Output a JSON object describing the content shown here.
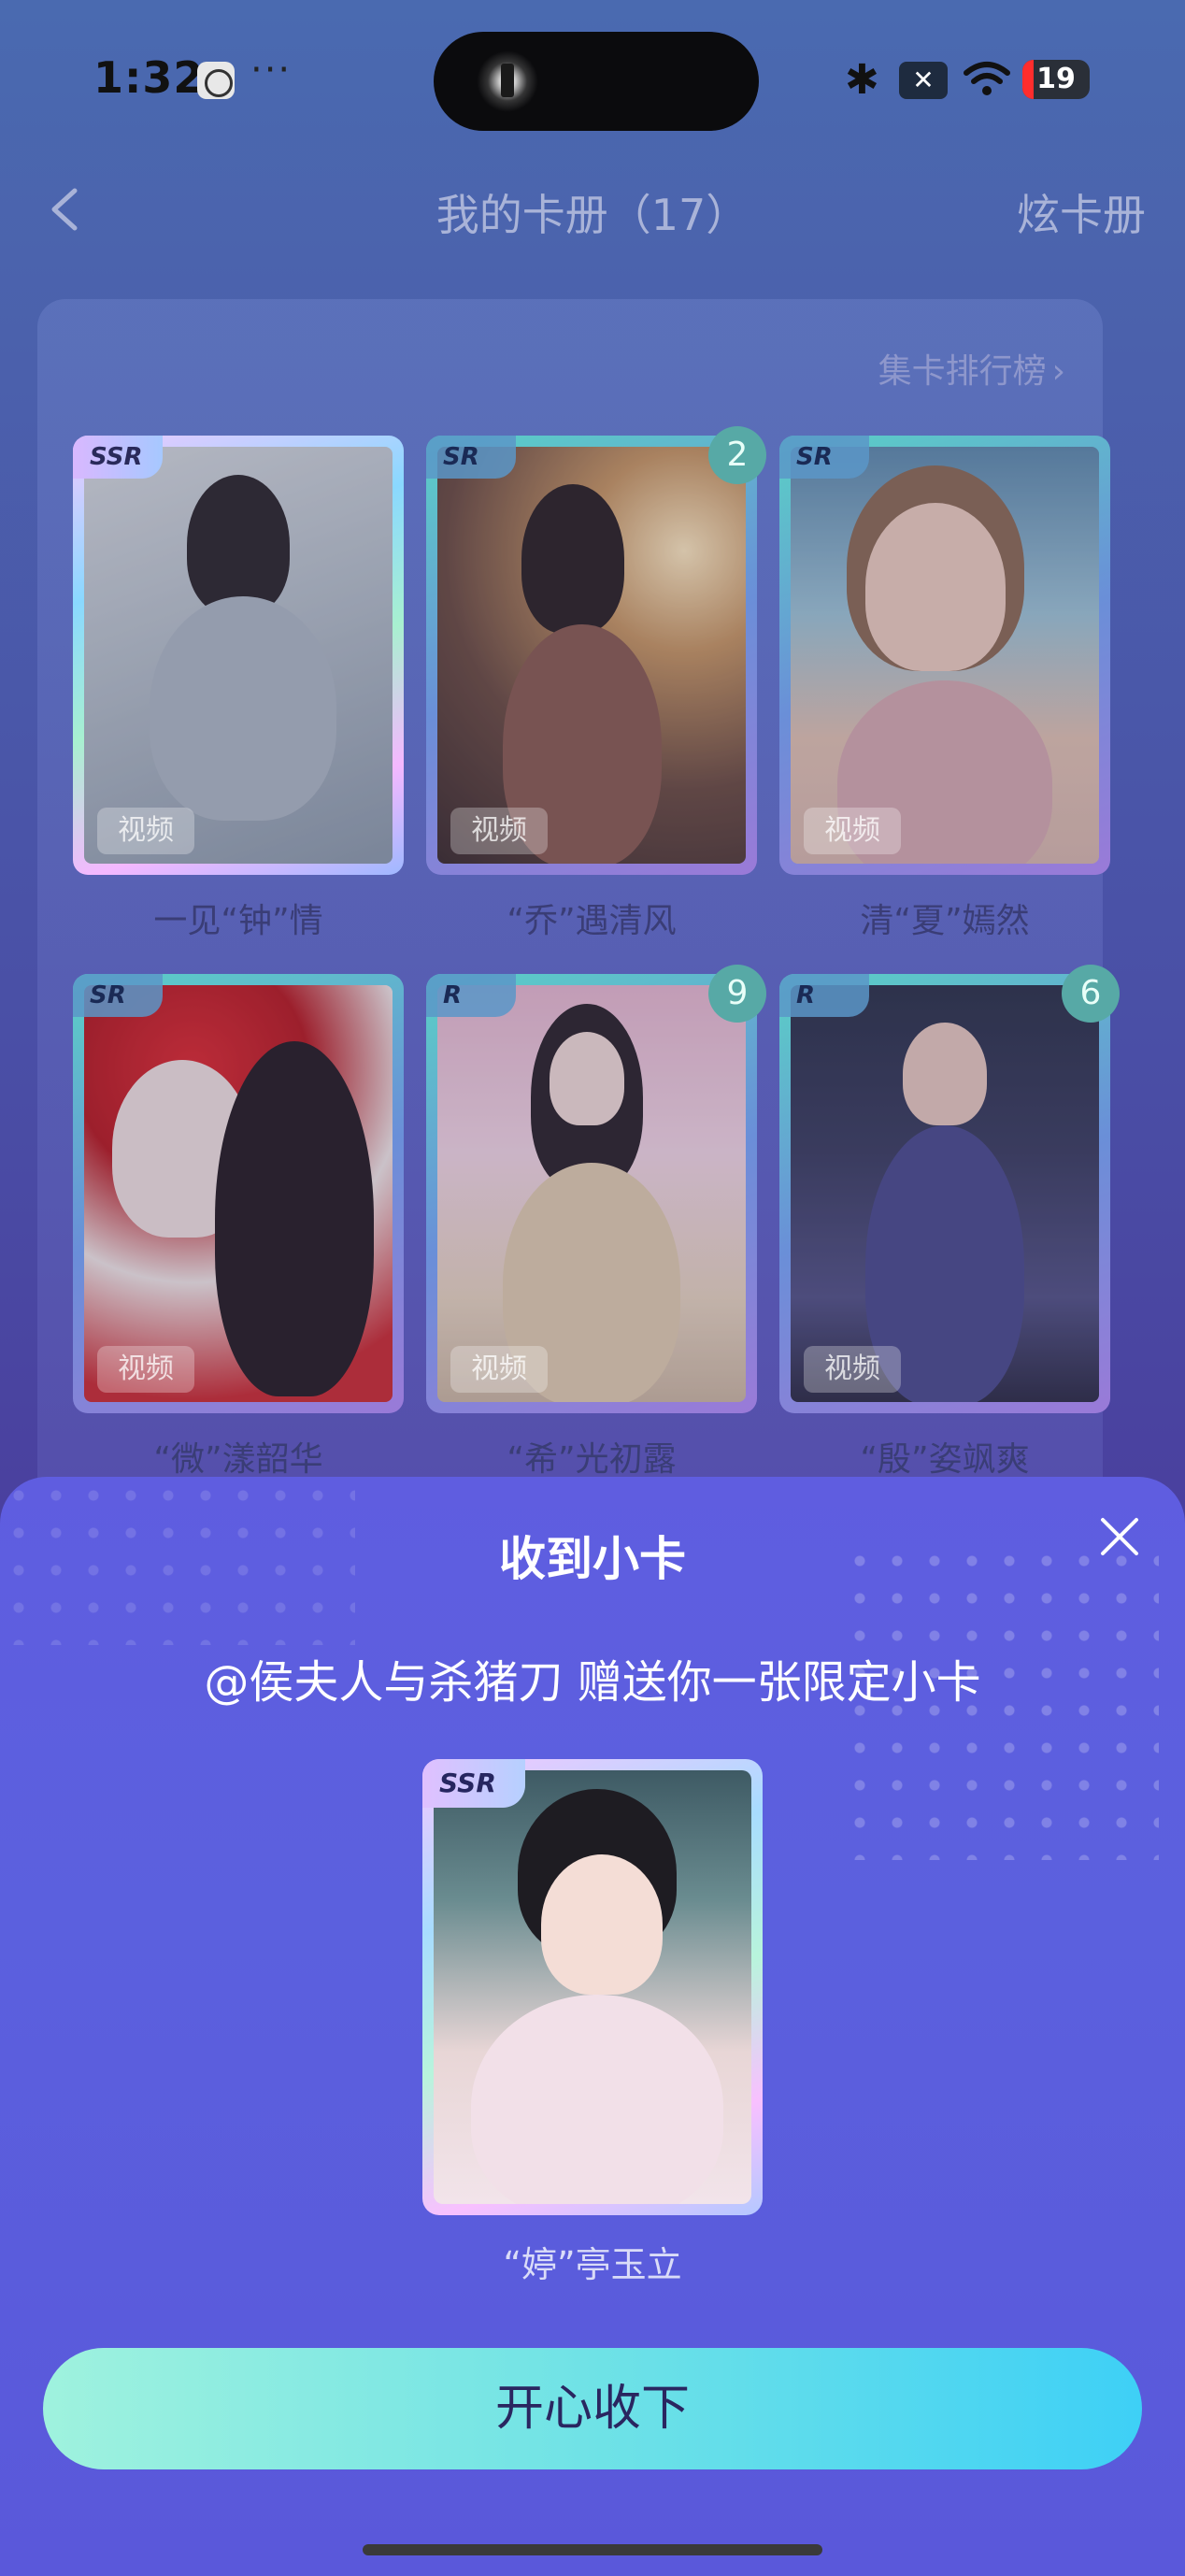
{
  "status_bar": {
    "time": "1:32",
    "dots": "···",
    "battery": "19"
  },
  "nav": {
    "title": "我的卡册（17）",
    "right_action": "炫卡册"
  },
  "album": {
    "rank_link": "集卡排行榜",
    "video_label": "视频",
    "cards": [
      {
        "name": "一见“钟”情",
        "rarity": "SSR",
        "count": ""
      },
      {
        "name": "“乔”遇清风",
        "rarity": "SR",
        "count": "2"
      },
      {
        "name": "清“夏”嫣然",
        "rarity": "SR",
        "count": ""
      },
      {
        "name": "“微”漾韶华",
        "rarity": "SR",
        "count": ""
      },
      {
        "name": "“希”光初露",
        "rarity": "R",
        "count": "9"
      },
      {
        "name": "“殷”姿飒爽",
        "rarity": "R",
        "count": "6"
      }
    ]
  },
  "gift_sheet": {
    "title": "收到小卡",
    "message": "@侯夫人与杀猪刀 赠送你一张限定小卡",
    "card": {
      "rarity": "SSR",
      "name": "“婷”亭玉立"
    },
    "accept_label": "开心收下"
  },
  "colors": {
    "background": "#4a4fa6",
    "sheet": "#5f5de0",
    "accept_button_start": "#9ff2de",
    "accept_button_end": "#3ed0f6",
    "count_badge": "#57a9a6"
  }
}
